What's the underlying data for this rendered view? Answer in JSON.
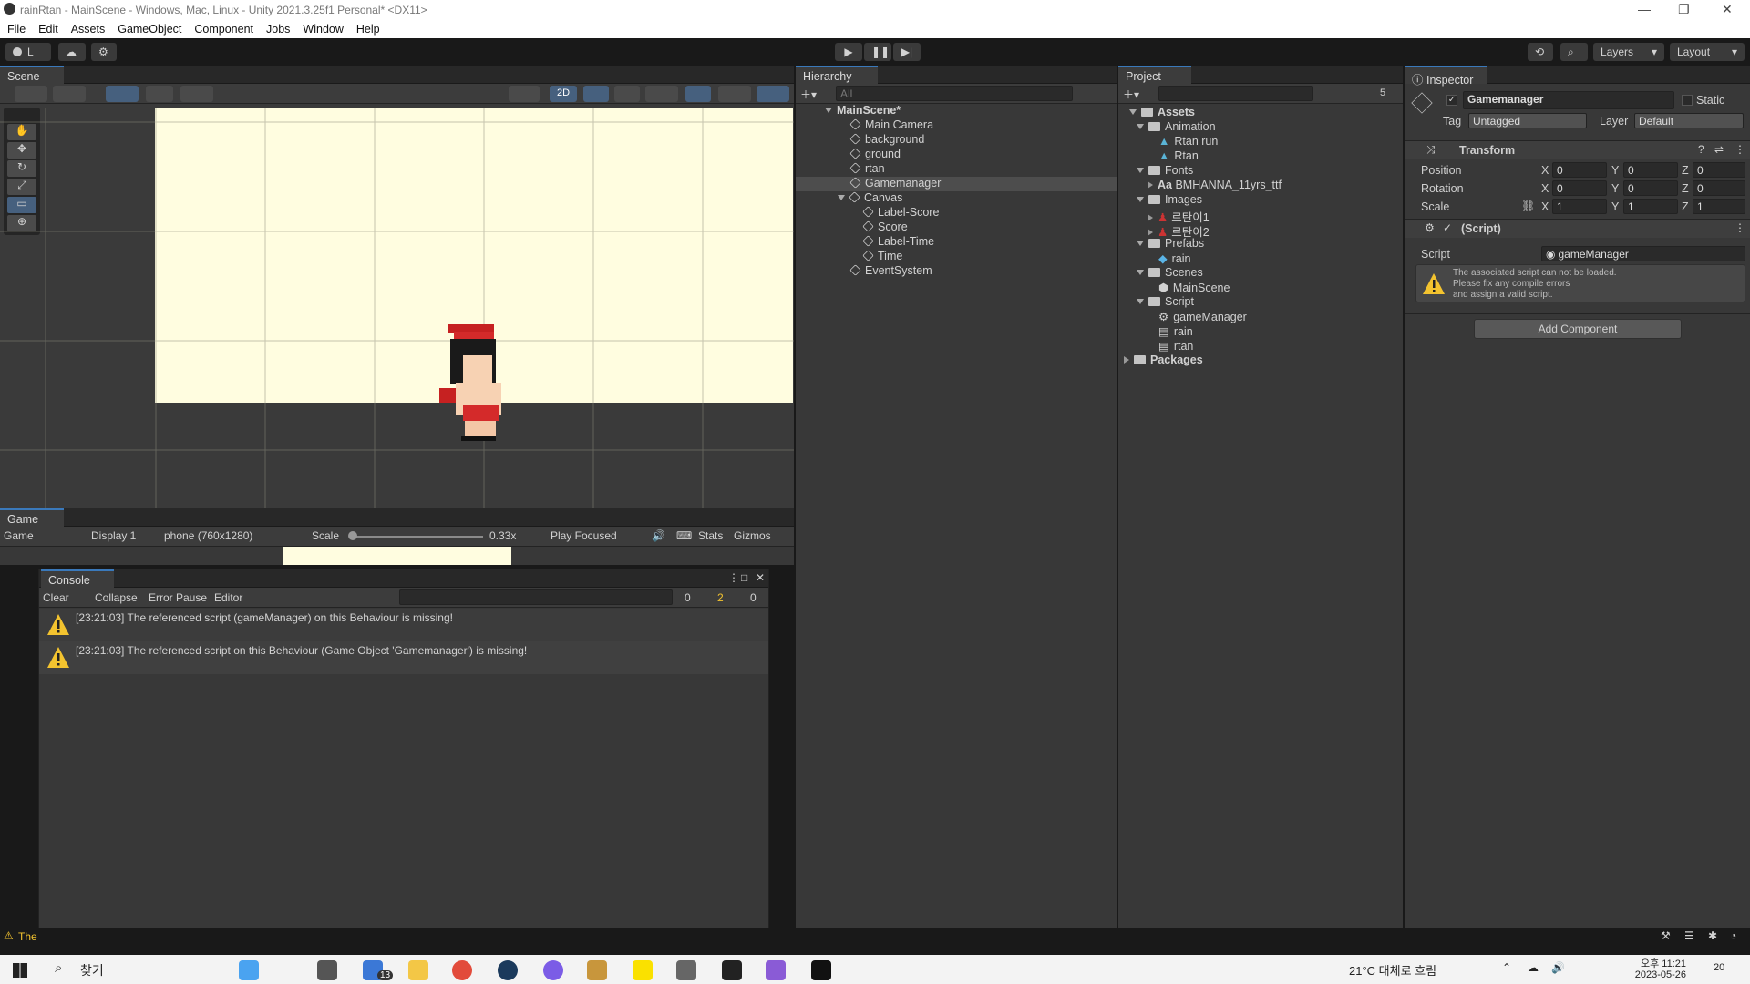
{
  "window": {
    "title": "rainRtan - MainScene - Windows, Mac, Linux - Unity 2021.3.25f1 Personal* <DX11>",
    "min": "—",
    "max": "❐",
    "close": "✕"
  },
  "menu": [
    "File",
    "Edit",
    "Assets",
    "GameObject",
    "Component",
    "Jobs",
    "Window",
    "Help"
  ],
  "toolbar": {
    "account": "L",
    "layers": "Layers",
    "layout": "Layout"
  },
  "scene": {
    "tab": "Scene",
    "mode2d": "2D"
  },
  "game": {
    "tab": "Game",
    "view": "Game",
    "display": "Display 1",
    "resolution": "phone (760x1280)",
    "scale_label": "Scale",
    "scale_value": "0.33x",
    "play_mode": "Play Focused",
    "stats": "Stats",
    "gizmos": "Gizmos"
  },
  "console": {
    "tab": "Console",
    "clear": "Clear",
    "collapse": "Collapse",
    "error_pause": "Error Pause",
    "editor": "Editor",
    "count_info": "0",
    "count_warn": "2",
    "count_err": "0",
    "messages": [
      "[23:21:03] The referenced script (gameManager) on this Behaviour is missing!",
      "[23:21:03] The referenced script on this Behaviour (Game Object 'Gamemanager') is missing!"
    ],
    "status_text": "The"
  },
  "hierarchy": {
    "tab": "Hierarchy",
    "search": "All",
    "scene": "MainScene*",
    "items": [
      "Main Camera",
      "background",
      "ground",
      "rtan",
      "Gamemanager",
      "Canvas",
      "Label-Score",
      "Score",
      "Label-Time",
      "Time",
      "EventSystem"
    ]
  },
  "project": {
    "tab": "Project",
    "hidden_count": "5",
    "assets": "Assets",
    "animation": "Animation",
    "rtan_run": "Rtan run",
    "rtan": "Rtan",
    "fonts": "Fonts",
    "font_file": "BMHANNA_11yrs_ttf",
    "font_prefix": "Aa",
    "images": "Images",
    "img1": "르탄이1",
    "img2": "르탄이2",
    "prefabs": "Prefabs",
    "rain": "rain",
    "scenes": "Scenes",
    "mainscene": "MainScene",
    "script": "Script",
    "gamemanager": "gameManager",
    "rain_s": "rain",
    "rtan_s": "rtan",
    "packages": "Packages"
  },
  "inspector": {
    "tab": "Inspector",
    "name": "Gamemanager",
    "static": "Static",
    "tag_label": "Tag",
    "tag": "Untagged",
    "layer_label": "Layer",
    "layer": "Default",
    "transform": "Transform",
    "position": "Position",
    "rotation": "Rotation",
    "scale": "Scale",
    "pos": [
      "0",
      "0",
      "0"
    ],
    "rot": [
      "0",
      "0",
      "0"
    ],
    "scl": [
      "1",
      "1",
      "1"
    ],
    "x": "X",
    "y": "Y",
    "z": "Z",
    "script_comp": "(Script)",
    "script_label": "Script",
    "script_value": "gameManager",
    "warning": [
      "The associated script can not be loaded.",
      "Please fix any compile errors",
      "and assign a valid script."
    ],
    "add_component": "Add Component"
  },
  "taskbar": {
    "search": "찾기",
    "mail_badge": "13",
    "weather": "21°C 대체로 흐림",
    "time": "오후 11:21",
    "date": "2023-05-26",
    "notif": "20"
  },
  "colors": {
    "bg": "#383838",
    "scene_sky": "#fffde0",
    "accent": "#3a79bb",
    "warning": "#f3c32f"
  }
}
